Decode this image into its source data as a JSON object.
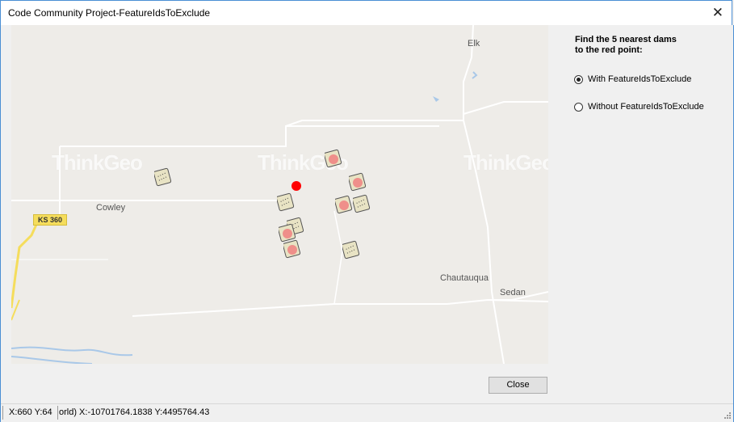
{
  "window": {
    "title": "Code Community Project-FeatureIdsToExclude",
    "close_glyph": "✕"
  },
  "map": {
    "labels": {
      "elk": "Elk",
      "cowley": "Cowley",
      "chautauqua": "Chautauqua",
      "sedan": "Sedan",
      "ks360": "KS 360"
    },
    "watermark_text": "ThinkGeo",
    "colors": {
      "background": "#eeece8",
      "road": "#ffffff",
      "highway": "#f5dd5c",
      "water": "#a9c8e8",
      "query_point": "#ff0000",
      "highlight": "#f08080"
    },
    "query_point_icon": "red-dot",
    "dam_icon": "dam-icon"
  },
  "panel": {
    "instruction_line1": "Find the 5 nearest dams",
    "instruction_line2": "to the red point:",
    "option_with": "With FeatureIdsToExclude",
    "option_without": "Without FeatureIdsToExclude",
    "selected_option": "with"
  },
  "buttons": {
    "close_label": "Close"
  },
  "status": {
    "screen_pos": "X:660 Y:64",
    "world_pos": "orld) X:-10701764.1838 Y:4495764.43"
  }
}
